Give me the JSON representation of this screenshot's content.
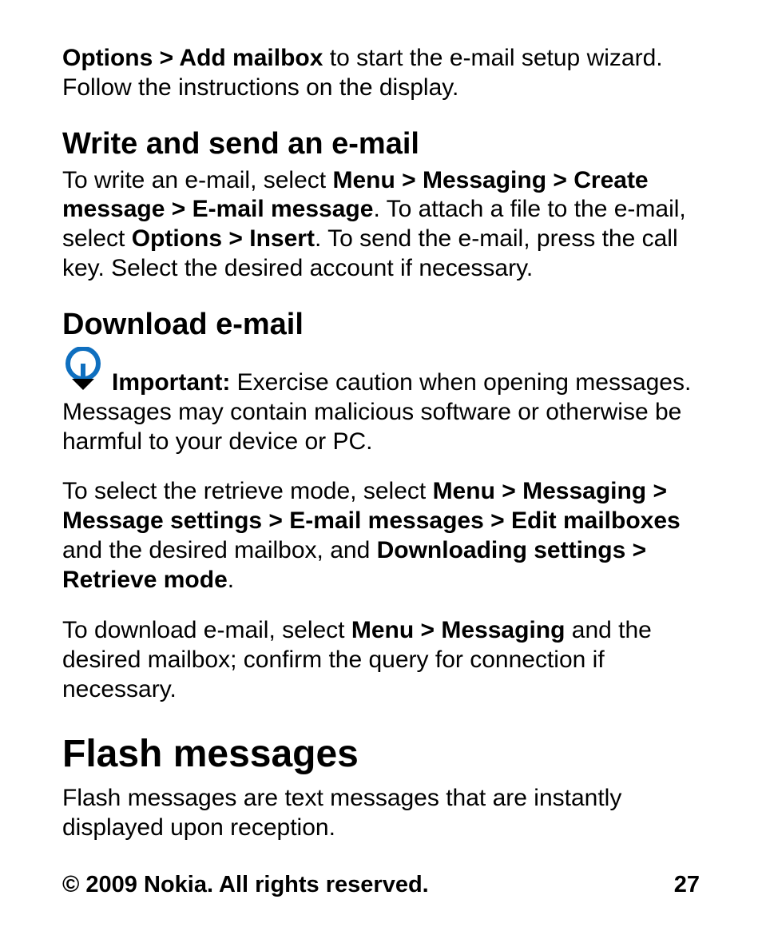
{
  "p1": {
    "s0": "Options",
    "sep1": " > ",
    "s1": "Add mailbox",
    "s2": " to start the e-mail setup wizard. Follow the instructions on the display."
  },
  "h2a": "Write and send an e-mail",
  "p2": {
    "s0": "To write an e-mail, select ",
    "s1": "Menu",
    "sep": " > ",
    "s2": "Messaging",
    "s3": "Create message",
    "s4": "E-mail message",
    "s5": ". To attach a file to the e-mail, select ",
    "s6": "Options",
    "s7": "Insert",
    "s8": ". To send the e-mail, press the call key. Select the desired account if necessary."
  },
  "h2b": "Download e-mail",
  "p3": {
    "label": "Important:",
    "text": "  Exercise caution when opening messages. Messages may contain malicious software or otherwise be harmful to your device or PC."
  },
  "p4": {
    "s0": "To select the retrieve mode, select ",
    "s1": "Menu",
    "sep": " > ",
    "s2": "Messaging",
    "s3": "Message settings",
    "s4": "E-mail messages",
    "s5": "Edit mailboxes",
    "s6": " and the desired mailbox, and ",
    "s7": "Downloading settings",
    "s8": "Retrieve mode",
    "s9": "."
  },
  "p5": {
    "s0": "To download e-mail, select ",
    "s1": "Menu",
    "sep": " > ",
    "s2": "Messaging",
    "s3": " and the desired mailbox; confirm the query for connection if necessary."
  },
  "h1": "Flash messages",
  "p6": "Flash messages are text messages that are instantly displayed upon reception.",
  "footer": {
    "copyright": "© 2009 Nokia. All rights reserved.",
    "page": "27"
  }
}
